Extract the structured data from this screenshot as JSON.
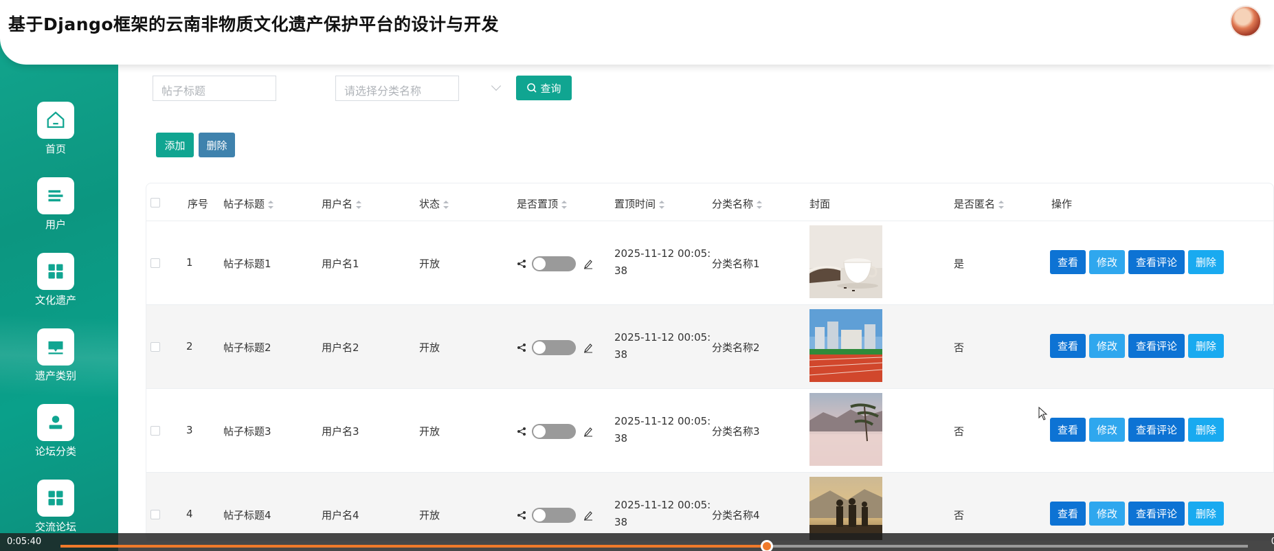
{
  "header": {
    "title": "基于Django框架的云南非物质文化遗产保护平台的设计与开发"
  },
  "sidebar": {
    "items": [
      {
        "label": "首页",
        "icon": "home-icon"
      },
      {
        "label": "用户",
        "icon": "user-list-icon"
      },
      {
        "label": "文化遗产",
        "icon": "grid-icon"
      },
      {
        "label": "遗产类别",
        "icon": "category-icon"
      },
      {
        "label": "论坛分类",
        "icon": "person-icon"
      },
      {
        "label": "交流论坛",
        "icon": "grid-icon"
      }
    ]
  },
  "filters": {
    "title_placeholder": "帖子标题",
    "category_placeholder": "请选择分类名称",
    "query_label": "查询"
  },
  "actions": {
    "add_label": "添加",
    "delete_label": "删除"
  },
  "table": {
    "columns": [
      "序号",
      "帖子标题",
      "用户名",
      "状态",
      "是否置顶",
      "置顶时间",
      "分类名称",
      "封面",
      "是否匿名",
      "操作"
    ],
    "op_labels": {
      "view": "查看",
      "edit": "修改",
      "comments": "查看评论",
      "delete": "删除"
    },
    "rows": [
      {
        "index": "1",
        "title": "帖子标题1",
        "user": "用户名1",
        "status": "开放",
        "time_line1": "2025-11-12 00:05:",
        "time_line2": "38",
        "category": "分类名称1",
        "anonymous": "是",
        "cover": "coffee-cup-image"
      },
      {
        "index": "2",
        "title": "帖子标题2",
        "user": "用户名2",
        "status": "开放",
        "time_line1": "2025-11-12 00:05:",
        "time_line2": "38",
        "category": "分类名称2",
        "anonymous": "否",
        "cover": "running-track-image"
      },
      {
        "index": "3",
        "title": "帖子标题3",
        "user": "用户名3",
        "status": "开放",
        "time_line1": "2025-11-12 00:05:",
        "time_line2": "38",
        "category": "分类名称3",
        "anonymous": "否",
        "cover": "mountain-mist-image"
      },
      {
        "index": "4",
        "title": "帖子标题4",
        "user": "用户名4",
        "status": "开放",
        "time_line1": "2025-11-12 00:05:",
        "time_line2": "38",
        "category": "分类名称4",
        "anonymous": "否",
        "cover": "hikers-sunset-image"
      }
    ]
  },
  "video": {
    "current_time": "0:05:40",
    "end_text": "0",
    "progress": 0.595
  },
  "colors": {
    "sidebar": "#0c9680",
    "primary": "#10a591",
    "delete_top": "#3f82ad",
    "view": "#0d73d4",
    "edit": "#2fa7ee",
    "progress": "#f07a2a"
  }
}
